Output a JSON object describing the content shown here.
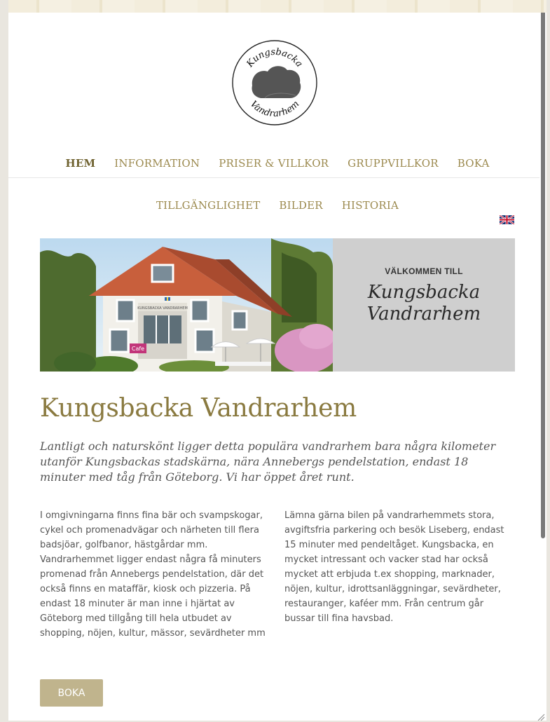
{
  "nav": {
    "primary": [
      {
        "label": "HEM",
        "active": true
      },
      {
        "label": "INFORMATION"
      },
      {
        "label": "PRISER & VILLKOR"
      },
      {
        "label": "GRUPPVILLKOR"
      },
      {
        "label": "BOKA"
      }
    ],
    "secondary": [
      {
        "label": "TILLGÄNGLIGHET"
      },
      {
        "label": "BILDER"
      },
      {
        "label": "HISTORIA"
      }
    ]
  },
  "logo": {
    "top_text": "Kungsbacka",
    "bottom_text": "Vandrarhem"
  },
  "language": {
    "icon": "uk-flag-icon"
  },
  "hero": {
    "welcome": "VÄLKOMMEN TILL",
    "name_line1": "Kungsbacka",
    "name_line2": "Vandrarhem",
    "cafe_sign": "Cafe",
    "house_sign": "KUNGSBACKA VANDRARHEM"
  },
  "main": {
    "title": "Kungsbacka Vandrarhem",
    "lead": "Lantligt och naturskönt ligger detta populära vandrarhem bara några kilometer utanför Kungsbackas stadskärna, nära Annebergs pendelstation, endast 18 minuter med tåg från Göteborg. Vi har öppet året runt.",
    "col1": "I omgivningarna finns fina bär och svampskogar, cykel och promenadvägar och närheten till flera badsjöar, golfbanor, hästgårdar mm. Vandrarhemmet ligger endast några få minuters promenad från Annebergs pendelstation, där det också finns en mataffär, kiosk och pizzeria. På endast 18 minuter är man inne i hjärtat av Göteborg med tillgång till hela utbudet av shopping, nöjen, kultur, mässor, sevärdheter mm",
    "col2": "Lämna gärna bilen på vandrarhemmets stora, avgiftsfria parkering och besök Liseberg, endast 15 minuter med pendeltåget. Kungsbacka, en mycket intressant och vacker stad har också mycket att erbjuda t.ex shopping, marknader, nöjen, kultur, idrottsanläggningar, sevärdheter, restauranger, kaféer mm. Från centrum går bussar till fina havsbad.",
    "button": "BOKA"
  },
  "colors": {
    "accent": "#9c8a4f",
    "button": "#c0b48d",
    "text": "#555555"
  }
}
